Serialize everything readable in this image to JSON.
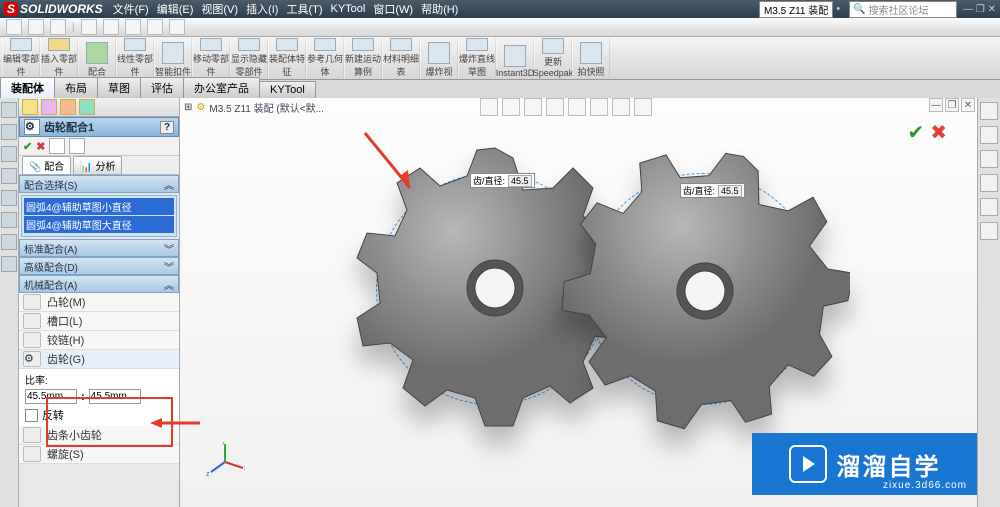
{
  "app": {
    "brand": "SOLIDWORKS",
    "doc_title": "M3.5 Z11 装配"
  },
  "menu": [
    "文件(F)",
    "编辑(E)",
    "视图(V)",
    "插入(I)",
    "工具(T)",
    "KYTool",
    "窗口(W)",
    "帮助(H)"
  ],
  "search": {
    "placeholder": "搜索社区论坛"
  },
  "ribbon": [
    "编辑零部件",
    "插入零部件",
    "配合",
    "线性零部件",
    "智能扣件",
    "移动零部件",
    "显示隐藏零部件",
    "装配体特征",
    "参考几何体",
    "新建运动算例",
    "材料明细表",
    "爆炸视",
    "爆炸直线草图",
    "Instant3D",
    "更新Speedpak",
    "拍快照"
  ],
  "tabs": [
    "装配体",
    "布局",
    "草图",
    "评估",
    "办公室产品",
    "KYTool"
  ],
  "breadcrumb": "M3.5 Z11 装配  (默认<默...",
  "feature": {
    "title": "齿轮配合1"
  },
  "subtabs": [
    "配合",
    "分析"
  ],
  "sections": {
    "sel": "配合选择(S)",
    "std": "标准配合(A)",
    "adv": "高级配合(D)",
    "mech": "机械配合(A)"
  },
  "selection": [
    "圆弧4@辅助草图小直径",
    "圆弧4@辅助草图大直径"
  ],
  "mech_opts": {
    "cam": "凸轮(M)",
    "slot": "槽口(L)",
    "hinge": "铰链(H)",
    "gear": "齿轮(G)",
    "rack": "齿条小齿轮",
    "screw": "螺旋(S)"
  },
  "ratio": {
    "label": "比率:",
    "a": "45.5mm",
    "b": "45.5mm",
    "sep": ":",
    "rev": "反转"
  },
  "dim": {
    "label": "齿/直径:",
    "value": "45.5"
  },
  "watermark": {
    "text": "溜溜自学",
    "url": "zixue.3d66.com"
  }
}
